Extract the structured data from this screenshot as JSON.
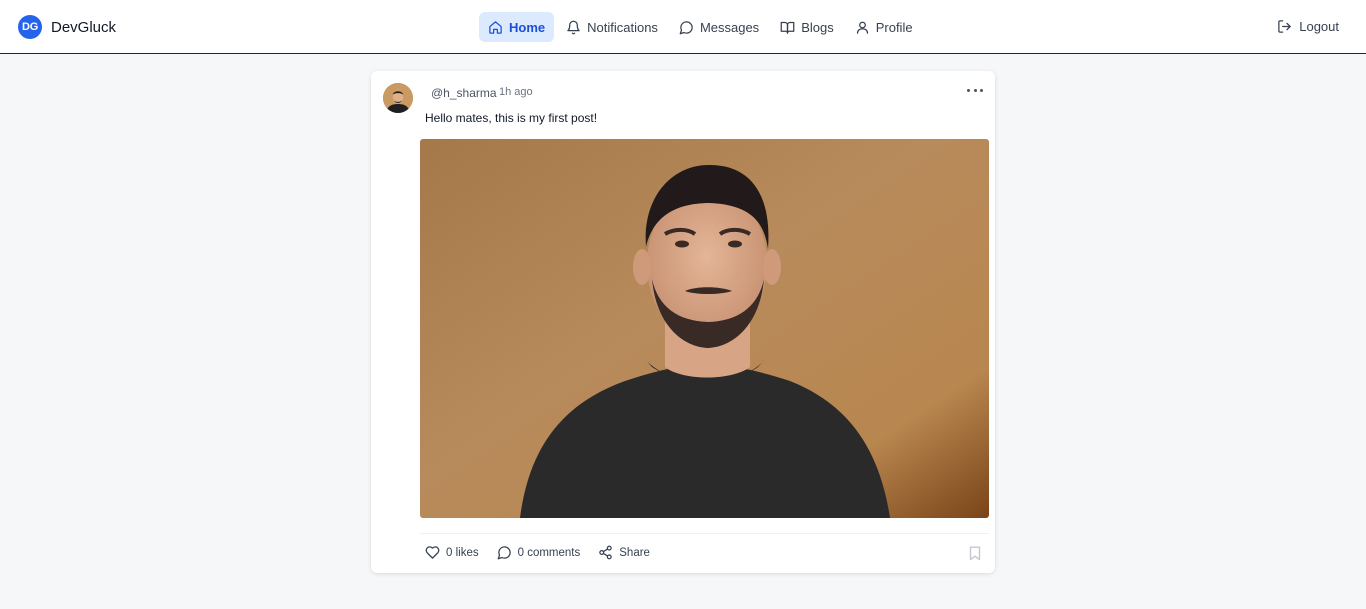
{
  "brand": {
    "logo_text": "DG",
    "name": "DevGluck",
    "color": "#2563eb"
  },
  "nav": {
    "items": [
      {
        "label": "Home",
        "icon": "home-icon",
        "active": true
      },
      {
        "label": "Notifications",
        "icon": "bell-icon"
      },
      {
        "label": "Messages",
        "icon": "message-icon"
      },
      {
        "label": "Blogs",
        "icon": "book-icon"
      },
      {
        "label": "Profile",
        "icon": "user-icon"
      }
    ],
    "active_color": "#1d4ed8"
  },
  "logout": {
    "label": "Logout",
    "icon": "logout-icon"
  },
  "post": {
    "username": "@h_sharma",
    "time": "1h ago",
    "text": "Hello mates, this is my first post!",
    "image_alt_icon": "portrait-photo",
    "likes_label": "0 likes",
    "comments_label": "0 comments",
    "share_label": "Share"
  }
}
